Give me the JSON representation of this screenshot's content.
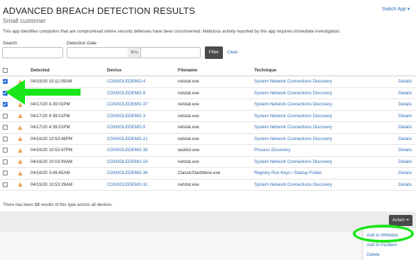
{
  "header": {
    "title": "ADVANCED BREACH DETECTION RESULTS",
    "subtitle": "Small customer",
    "switch_app": "Switch App ▾",
    "description": "This app identifies computers that are compromised where security defenses have been circumvented. Malicious activity reported by this app requires immediate investigation."
  },
  "filters": {
    "search_label": "Search",
    "date_label": "Detection Date",
    "thru": "thru",
    "filter_button": "Filter",
    "clear_link": "Clear"
  },
  "table": {
    "columns": [
      "Detected",
      "Device",
      "Filename",
      "Technique"
    ],
    "rows": [
      {
        "checked": true,
        "detected": "04/19/20 10:11:09AM",
        "device": "CONSOLEDEMO-4",
        "filename": "netstat.exe",
        "technique": "System Network Connections Discovery",
        "details": "Details"
      },
      {
        "checked": true,
        "detected": "04/17/20 4:39:01PM",
        "device": "CONSOLEDEMO-9",
        "filename": "netstat.exe",
        "technique": "System Network Connections Discovery",
        "details": "Details"
      },
      {
        "checked": true,
        "detected": "04/17/20 4:39:01PM",
        "device": "CONSOLEDEMO-37",
        "filename": "netstat.exe",
        "technique": "System Network Connections Discovery",
        "details": "Details"
      },
      {
        "checked": false,
        "detected": "04/17/20 4:39:01PM",
        "device": "CONSOLEDEMO-3",
        "filename": "netstat.exe",
        "technique": "System Network Connections Discovery",
        "details": "Details"
      },
      {
        "checked": false,
        "detected": "04/17/20 4:39:01PM",
        "device": "CONSOLEDEMO-9",
        "filename": "netstat.exe",
        "technique": "System Network Connections Discovery",
        "details": "Details"
      },
      {
        "checked": false,
        "detected": "04/16/20 10:53:48PM",
        "device": "CONSOLEDEMO-21",
        "filename": "netstat.exe",
        "technique": "System Network Connections Discovery",
        "details": "Details"
      },
      {
        "checked": false,
        "detected": "04/16/20 10:53:47PM",
        "device": "CONSOLEDEMO-35",
        "filename": "tasklist.exe",
        "technique": "Process Discovery",
        "details": "Details"
      },
      {
        "checked": false,
        "detected": "04/16/20 10:03:09AM",
        "device": "CONSOLEDEMO-18",
        "filename": "netstat.exe",
        "technique": "System Network Connections Discovery",
        "details": "Details"
      },
      {
        "checked": false,
        "detected": "04/16/20 3:49:45AM",
        "device": "CONSOLEDEMO-36",
        "filename": "ClassicStartMenu.exe",
        "technique": "Registry Run Keys / Startup Folder",
        "details": "Details"
      },
      {
        "checked": false,
        "detected": "04/15/20 10:53:29AM",
        "device": "CONSOLEDEMO-31",
        "filename": "netstat.exe",
        "technique": "System Network Connections Discovery",
        "details": "Details"
      }
    ]
  },
  "summary": {
    "prefix": "There has been ",
    "count": "10",
    "suffix": " results of this type across all devices."
  },
  "actions": {
    "action_button": "Action",
    "menu": [
      "Add to Whitelist",
      "Add to Incident",
      "Delete"
    ]
  },
  "colors": {
    "link": "#2d6ab4",
    "warning": "#e8912b",
    "annotation_green": "#19e619",
    "button_dark": "#4a4a4a"
  }
}
